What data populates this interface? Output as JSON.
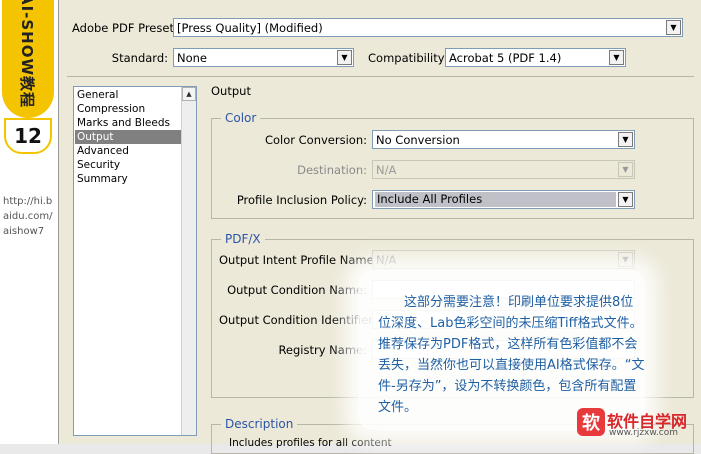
{
  "side_banner": {
    "title": "AI-SHOW教程",
    "number": "12",
    "url": "http://hi.baidu.com/aishow7"
  },
  "dialog": {
    "preset_label": "Adobe PDF Preset:",
    "preset_value": "[Press Quality] (Modified)",
    "standard_label": "Standard:",
    "standard_value": "None",
    "compat_label": "Compatibility:",
    "compat_value": "Acrobat 5 (PDF 1.4)",
    "categories": [
      {
        "label": "General"
      },
      {
        "label": "Compression"
      },
      {
        "label": "Marks and Bleeds"
      },
      {
        "label": "Output"
      },
      {
        "label": "Advanced"
      },
      {
        "label": "Security"
      },
      {
        "label": "Summary"
      }
    ],
    "selected_category": "Output",
    "panel_title": "Output",
    "color": {
      "title": "Color",
      "conversion_label": "Color Conversion:",
      "conversion_value": "No Conversion",
      "destination_label": "Destination:",
      "destination_value": "N/A",
      "profile_label": "Profile Inclusion Policy:",
      "profile_value": "Include All Profiles"
    },
    "pdfx": {
      "title": "PDF/X",
      "intent_label": "Output Intent Profile Name:",
      "intent_value": "N/A",
      "condition_name_label": "Output Condition Name:",
      "condition_id_label": "Output Condition Identifier:",
      "registry_label": "Registry Name:"
    },
    "description": {
      "title": "Description",
      "text": "Includes profiles for all content"
    }
  },
  "annotation": {
    "text": "这部分需要注意！印刷单位要求提供8位位深度、Lab色彩空间的未压缩Tiff格式文件。推荐保存为PDF格式，这样所有色彩值都不会丢失，当然你也可以直接使用AI格式保存。“文件-另存为”，设为不转换颜色，包含所有配置文件。"
  },
  "watermark": {
    "mark": "软",
    "name": "软件自学网",
    "site": "www.rjzxw.com"
  },
  "colors": {
    "accent_blue": "#2c55a6",
    "banner_yellow": "#f4c400",
    "note_blue": "#1f5fa3"
  }
}
